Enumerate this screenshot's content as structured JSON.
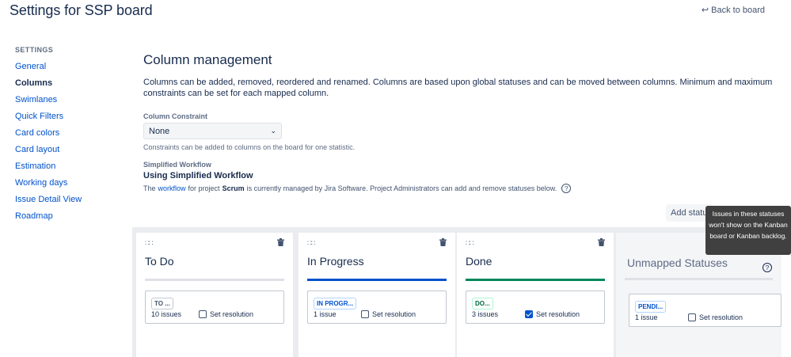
{
  "header": {
    "title": "Settings for SSP board",
    "back_label": "Back to board"
  },
  "sidebar": {
    "heading": "SETTINGS",
    "items": [
      {
        "label": "General"
      },
      {
        "label": "Columns"
      },
      {
        "label": "Swimlanes"
      },
      {
        "label": "Quick Filters"
      },
      {
        "label": "Card colors"
      },
      {
        "label": "Card layout"
      },
      {
        "label": "Estimation"
      },
      {
        "label": "Working days"
      },
      {
        "label": "Issue Detail View"
      },
      {
        "label": "Roadmap"
      }
    ],
    "active_index": 1
  },
  "main": {
    "title": "Column management",
    "description": "Columns can be added, removed, reordered and renamed. Columns are based upon global statuses and can be moved between columns. Minimum and maximum constraints can be set for each mapped column.",
    "constraint": {
      "label": "Column Constraint",
      "value": "None",
      "hint": "Constraints can be added to columns on the board for one statistic."
    },
    "workflow": {
      "label": "Simplified Workflow",
      "title": "Using Simplified Workflow",
      "text_before": "The",
      "link": "workflow",
      "text_mid": "for project",
      "project": "Scrum",
      "text_after": "is currently managed by Jira Software. Project Administrators can add and remove statuses below."
    },
    "add_status_label": "Add status",
    "tooltip": "Issues in these statuses won't show on the Kanban board or Kanban backlog."
  },
  "columns": [
    {
      "title": "To Do",
      "status": "TO ...",
      "count": "10 issues",
      "resolution_label": "Set resolution",
      "resolution_checked": false,
      "accent": "#dfe1e6"
    },
    {
      "title": "In Progress",
      "status": "IN PROGR...",
      "count": "1 issue",
      "resolution_label": "Set resolution",
      "resolution_checked": false,
      "accent": "#0052cc"
    },
    {
      "title": "Done",
      "status": "DO...",
      "count": "3 issues",
      "resolution_label": "Set resolution",
      "resolution_checked": true,
      "accent": "#00875a"
    },
    {
      "title": "Unmapped Statuses",
      "status": "PENDI...",
      "count": "1 issue",
      "resolution_label": "Set resolution",
      "resolution_checked": false,
      "accent": "#dfe1e6"
    }
  ]
}
